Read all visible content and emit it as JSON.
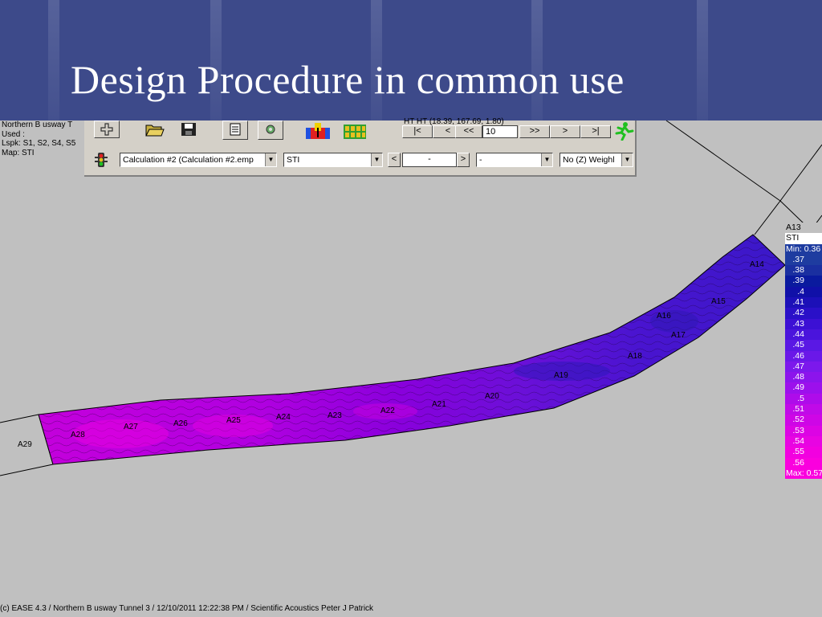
{
  "slide": {
    "title": "Design Procedure in common use"
  },
  "info": {
    "line1": "Northern B usway T",
    "line2": "Used :",
    "line3": "Lspk: S1, S2, S4, S5",
    "line4": "Map: STI"
  },
  "toolbar": {
    "coords_text": "HT HT (18.39, 167.69, 1.80)",
    "nav": {
      "first": "|<",
      "prev": "<",
      "rewind": "<<",
      "value": "10",
      "forward": ">>",
      "next": ">",
      "last": ">|"
    },
    "calculation_select": "Calculation #2 (Calculation #2.emp",
    "map_type_select": "STI",
    "left_arrow": "<",
    "mid_input": "-",
    "right_arrow": ">",
    "second_select": "-",
    "weighting_select": "No (Z) Weighl",
    "icons": [
      "new-icon",
      "open-folder-icon",
      "save-icon",
      "document-icon",
      "settings-icon",
      "color-map-icon",
      "audience-icon",
      "running-man-icon",
      "traffic-light-icon"
    ]
  },
  "map": {
    "area_labels": [
      "A13",
      "A14",
      "A15",
      "A16",
      "A17",
      "A18",
      "A19",
      "A20",
      "A21",
      "A22",
      "A23",
      "A24",
      "A25",
      "A26",
      "A27",
      "A28",
      "A29"
    ],
    "gradient_colors": [
      "#7a00c8",
      "#5a18d8",
      "#a800e0",
      "#d000e0",
      "#e200dc"
    ]
  },
  "legend": {
    "area": "A13",
    "metric": "STI",
    "min": "Min:  0.36",
    "values": [
      ".37",
      ".38",
      ".39",
      ".4",
      ".41",
      ".42",
      ".43",
      ".44",
      ".45",
      ".46",
      ".47",
      ".48",
      ".49",
      ".5",
      ".51",
      ".52",
      ".53",
      ".54",
      ".55",
      ".56"
    ],
    "colors": [
      "#1e3ca0",
      "#1a2fa0",
      "#0a1a9e",
      "#1010a8",
      "#1c10b8",
      "#2a10c8",
      "#3c10d4",
      "#4a14dc",
      "#5a18e4",
      "#6a18e8",
      "#7c18ec",
      "#8c14ec",
      "#9c10ec",
      "#ae0cea",
      "#c00ae8",
      "#ce06e6",
      "#dc04e4",
      "#e804e2",
      "#f200e0",
      "#fa00de"
    ],
    "max": "Max:  0.57"
  },
  "footer": {
    "text": "(c) EASE 4.3  / Northern B usway Tunnel 3  / 12/10/2011 12:22:38 PM / Scientific Acoustics Peter J Patrick"
  }
}
